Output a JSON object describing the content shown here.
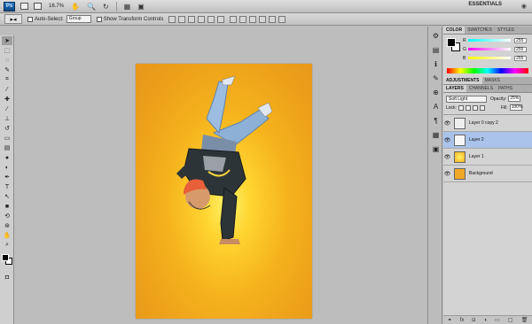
{
  "app": {
    "logo": "Ps",
    "zoom": "16.7%",
    "workspace": "ESSENTIALS",
    "icons": [
      "hand-icon",
      "zoom-icon",
      "rotate-icon",
      "grid-icon",
      "screen-mode-icon"
    ]
  },
  "options": {
    "auto_select_label": "Auto-Select:",
    "auto_select_value": "Group",
    "show_transform_label": "Show Transform Controls"
  },
  "toolbox": {
    "tools": [
      "move-tool",
      "marquee-tool",
      "lasso-tool",
      "quick-select-tool",
      "crop-tool",
      "eyedropper-tool",
      "spot-heal-tool",
      "brush-tool",
      "clone-stamp-tool",
      "history-brush-tool",
      "eraser-tool",
      "gradient-tool",
      "blur-tool",
      "dodge-tool",
      "pen-tool",
      "type-tool",
      "path-select-tool",
      "shape-tool",
      "3d-rotate-tool",
      "3d-orbit-tool",
      "hand-tool",
      "zoom-tool"
    ]
  },
  "color_panel": {
    "tabs": [
      "COLOR",
      "SWATCHES",
      "STYLES"
    ],
    "channels": [
      {
        "label": "R",
        "value": "255"
      },
      {
        "label": "G",
        "value": "255"
      },
      {
        "label": "B",
        "value": "255"
      }
    ]
  },
  "adjustments_panel": {
    "tabs": [
      "ADJUSTMENTS",
      "MASKS"
    ]
  },
  "layers_panel": {
    "tabs": [
      "LAYERS",
      "CHANNELS",
      "PATHS"
    ],
    "blend_mode": "Soft Light",
    "opacity_label": "Opacity:",
    "opacity_value": "25%",
    "lock_label": "Lock:",
    "fill_label": "Fill:",
    "fill_value": "100%",
    "layers": [
      {
        "name": "Layer 0 copy 2",
        "selected": false
      },
      {
        "name": "Layer 2",
        "selected": true
      },
      {
        "name": "Layer 1",
        "selected": false
      },
      {
        "name": "Background",
        "selected": false
      }
    ]
  }
}
